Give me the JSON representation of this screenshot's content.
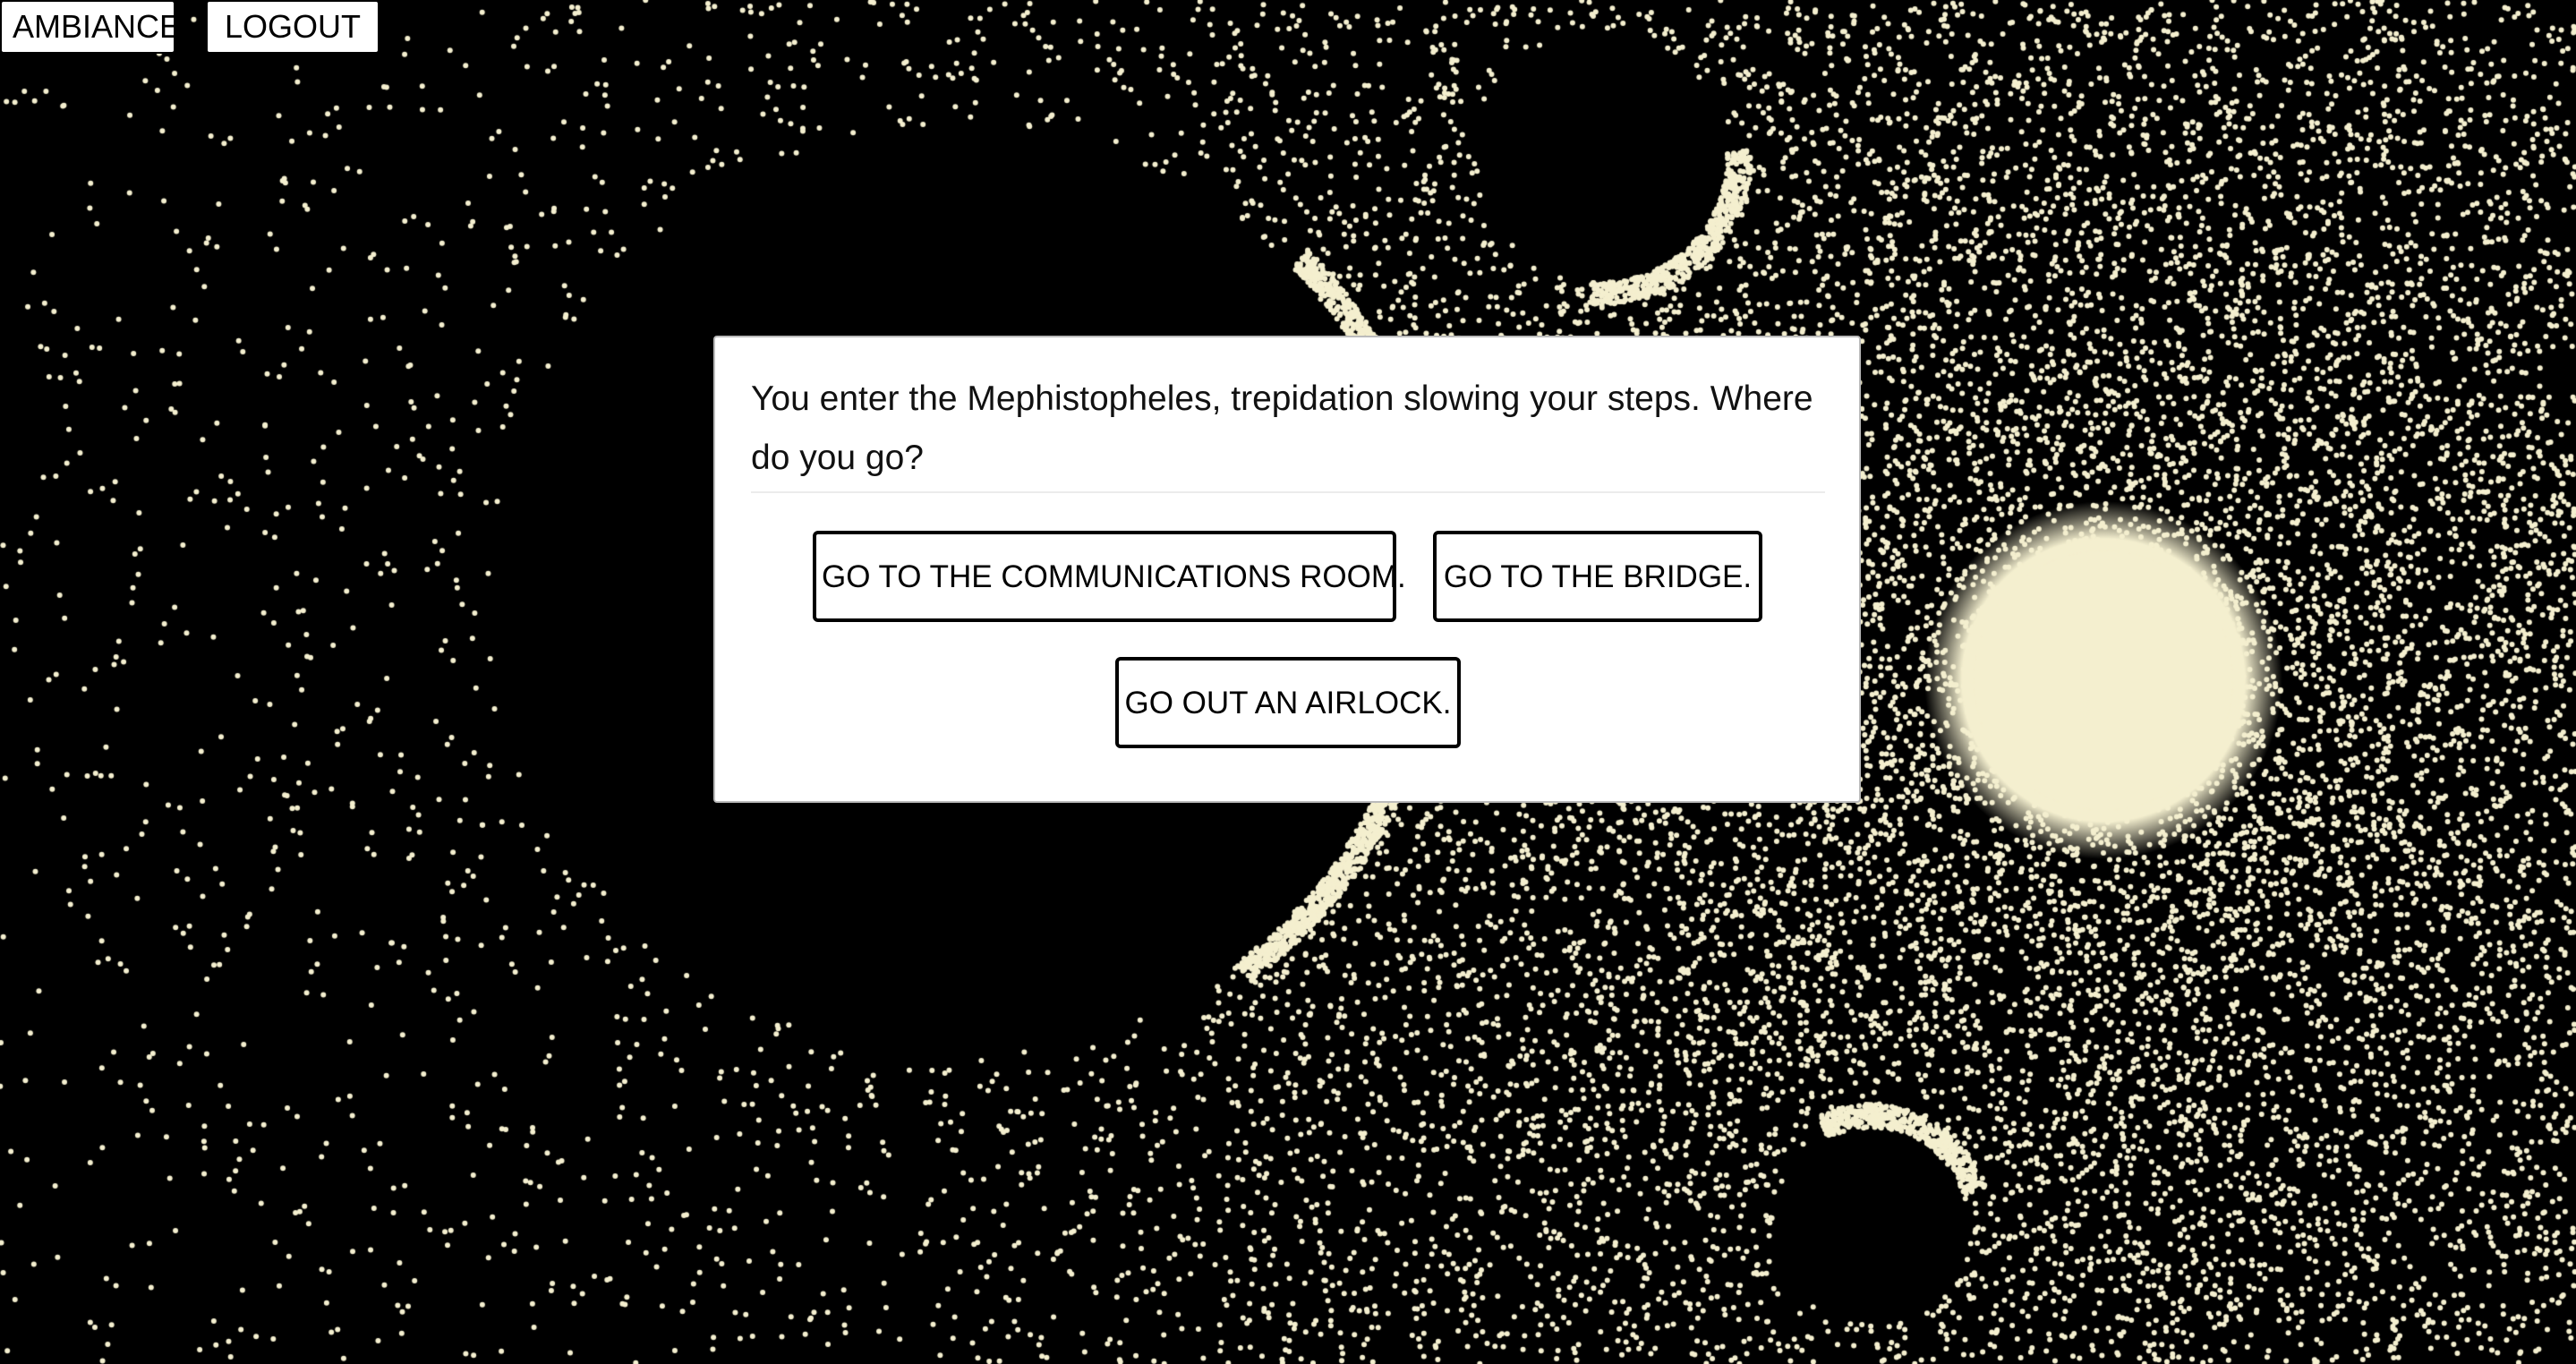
{
  "topbar": {
    "ambiance_label": "AMBIANCE",
    "logout_label": "LOGOUT"
  },
  "dialog": {
    "prompt": "You enter the Mephistopheles, trepidation slowing your steps. Where do you go?",
    "choices": [
      {
        "label": "GO TO THE COMMUNICATIONS ROOM."
      },
      {
        "label": "GO TO THE BRIDGE."
      },
      {
        "label": "GO OUT AN AIRLOCK."
      }
    ]
  },
  "colors": {
    "background": "#000000",
    "star": "#f4efcf",
    "panel": "#ffffff",
    "text": "#111111"
  }
}
